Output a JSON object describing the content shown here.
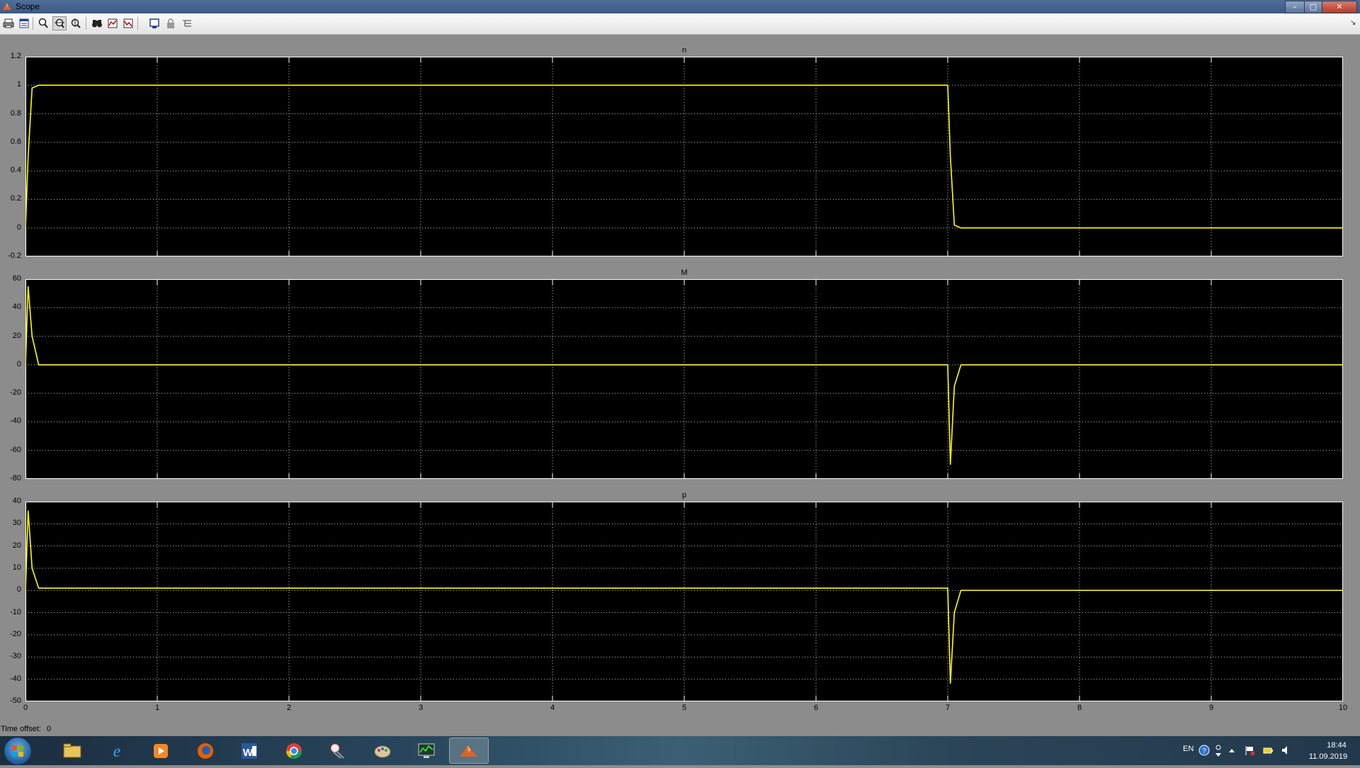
{
  "window": {
    "title": "Scope"
  },
  "toolbar": {
    "buttons": [
      {
        "name": "print-icon"
      },
      {
        "name": "parameters-icon"
      },
      {
        "name": "zoom-icon"
      },
      {
        "name": "zoom-x-icon"
      },
      {
        "name": "zoom-y-icon"
      },
      {
        "name": "autoscale-icon"
      },
      {
        "name": "save-axes-icon"
      },
      {
        "name": "restore-axes-icon"
      },
      {
        "name": "floating-scope-icon"
      },
      {
        "name": "lock-axes-icon"
      },
      {
        "name": "signal-selector-icon"
      }
    ]
  },
  "colors": {
    "plot_bg": "#000000",
    "trace": "#ffff00",
    "grid": "#bfbfbf",
    "figure_bg": "#8c8c8c"
  },
  "plots": [
    {
      "title": "n",
      "y_ticks": [
        "1.2",
        "1",
        "0.8",
        "0.6",
        "0.4",
        "0.2",
        "0",
        "-0.2"
      ]
    },
    {
      "title": "M",
      "y_ticks": [
        "60",
        "40",
        "20",
        "0",
        "-20",
        "-40",
        "-60",
        "-80"
      ]
    },
    {
      "title": "p",
      "y_ticks": [
        "40",
        "30",
        "20",
        "10",
        "0",
        "-10",
        "-20",
        "-30",
        "-40",
        "-50"
      ]
    }
  ],
  "x_ticks": [
    "0",
    "1",
    "2",
    "3",
    "4",
    "5",
    "6",
    "7",
    "8",
    "9",
    "10"
  ],
  "time_offset": {
    "label": "Time offset:",
    "value": "0"
  },
  "chart_data": [
    {
      "type": "line",
      "title": "n",
      "xlabel": "",
      "ylabel": "",
      "xlim": [
        0,
        10
      ],
      "ylim": [
        -0.2,
        1.2
      ],
      "grid": true,
      "series": [
        {
          "x": [
            0,
            0.02,
            0.05,
            0.1,
            7.0,
            7.02,
            7.05,
            7.1,
            10
          ],
          "y": [
            0,
            0.5,
            0.98,
            1.0,
            1.0,
            0.5,
            0.02,
            0.0,
            0.0
          ]
        }
      ]
    },
    {
      "type": "line",
      "title": "M",
      "xlabel": "",
      "ylabel": "",
      "xlim": [
        0,
        10
      ],
      "ylim": [
        -80,
        60
      ],
      "grid": true,
      "series": [
        {
          "x": [
            0,
            0.02,
            0.05,
            0.1,
            7.0,
            7.02,
            7.05,
            7.1,
            10
          ],
          "y": [
            0,
            55,
            20,
            0,
            0,
            -70,
            -15,
            0,
            0
          ]
        }
      ]
    },
    {
      "type": "line",
      "title": "p",
      "xlabel": "",
      "ylabel": "",
      "xlim": [
        0,
        10
      ],
      "ylim": [
        -50,
        40
      ],
      "grid": true,
      "series": [
        {
          "x": [
            0,
            0.02,
            0.05,
            0.1,
            7.0,
            7.02,
            7.05,
            7.1,
            10
          ],
          "y": [
            0,
            36,
            10,
            1,
            1,
            -42,
            -10,
            0,
            0
          ]
        }
      ]
    }
  ],
  "taskbar": {
    "apps": [
      {
        "name": "file-explorer-icon"
      },
      {
        "name": "internet-explorer-icon"
      },
      {
        "name": "media-player-icon"
      },
      {
        "name": "firefox-icon"
      },
      {
        "name": "word-icon"
      },
      {
        "name": "chrome-icon"
      },
      {
        "name": "snipping-tool-icon"
      },
      {
        "name": "paint-icon"
      },
      {
        "name": "task-manager-icon"
      },
      {
        "name": "matlab-icon"
      }
    ],
    "language": "EN",
    "time": "18:44",
    "date": "11.09.2019"
  }
}
